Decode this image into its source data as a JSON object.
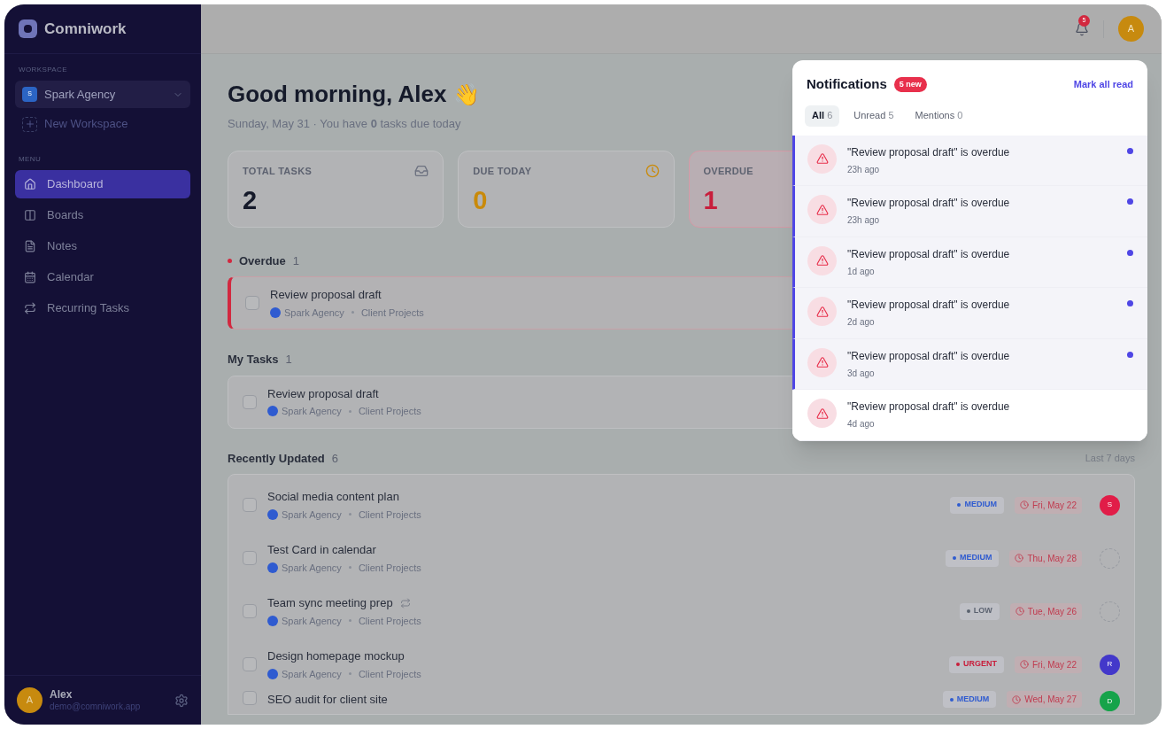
{
  "app": {
    "name": "Comniwork"
  },
  "sidebar": {
    "workspace_label": "WORKSPACE",
    "workspace": {
      "initial": "S",
      "name": "Spark Agency"
    },
    "new_workspace": "New Workspace",
    "menu_label": "MENU",
    "items": [
      {
        "label": "Dashboard",
        "kind": "home",
        "selected": true
      },
      {
        "label": "Boards",
        "kind": "boards",
        "selected": false
      },
      {
        "label": "Notes",
        "kind": "notes",
        "selected": false
      },
      {
        "label": "Calendar",
        "kind": "calendar",
        "selected": false
      },
      {
        "label": "Recurring Tasks",
        "kind": "repeat",
        "selected": false
      }
    ],
    "user": {
      "initial": "A",
      "name": "Alex",
      "email": "demo@comniwork.app"
    }
  },
  "header": {
    "bell_badge": "5",
    "avatar": "A"
  },
  "greeting": {
    "title": "Good morning, Alex",
    "emoji": "👋",
    "subtitle": "Sunday, May 31 · You have **0** tasks due today"
  },
  "stats": [
    {
      "label": "TOTAL TASKS",
      "value": "2",
      "kind": "total"
    },
    {
      "label": "DUE TODAY",
      "value": "0",
      "kind": "due"
    },
    {
      "label": "OVERDUE",
      "value": "1",
      "kind": "overdue"
    }
  ],
  "overdue": {
    "title": "Overdue",
    "count": "1",
    "tasks": [
      {
        "title": "Review proposal draft",
        "workspace": "Spark Agency",
        "project": "Client Projects",
        "checked": false
      }
    ]
  },
  "my_tasks": {
    "title": "My Tasks",
    "count": "1",
    "tasks": [
      {
        "title": "Review proposal draft",
        "workspace": "Spark Agency",
        "project": "Client Projects",
        "checked": false
      }
    ]
  },
  "recent": {
    "title": "Recently Updated",
    "count": "6",
    "range": "Last 7 days",
    "tasks": [
      {
        "title": "Social media content plan",
        "workspace": "Spark Agency",
        "project": "Client Projects",
        "checked": false,
        "recurring": false,
        "priority": {
          "label": "MEDIUM",
          "color": "#2f5bd0"
        },
        "date": "Fri, May 22",
        "assignee": {
          "initial": "S",
          "color": "#e11d48"
        }
      },
      {
        "title": "Test Card in calendar",
        "workspace": "Spark Agency",
        "project": "Client Projects",
        "checked": false,
        "recurring": false,
        "priority": {
          "label": "MEDIUM",
          "color": "#2f5bd0"
        },
        "date": "Thu, May 28"
      },
      {
        "title": "Team sync meeting prep",
        "workspace": "Spark Agency",
        "project": "Client Projects",
        "checked": false,
        "recurring": true,
        "priority": {
          "label": "LOW",
          "color": "#5b6270"
        },
        "date": "Tue, May 26"
      },
      {
        "title": "Design homepage mockup",
        "workspace": "Spark Agency",
        "project": "Client Projects",
        "checked": false,
        "recurring": false,
        "priority": {
          "label": "URGENT",
          "color": "#c81e3c"
        },
        "date": "Fri, May 22",
        "assignee": {
          "initial": "R",
          "color": "#4338ca"
        }
      },
      {
        "title": "SEO audit for client site",
        "checked": false,
        "recurring": false,
        "priority": {
          "label": "MEDIUM",
          "color": "#2f5bd0"
        },
        "date": "Wed, May 27",
        "assignee": {
          "initial": "D",
          "color": "#16a34a"
        }
      }
    ]
  },
  "notifications": {
    "title": "Notifications",
    "badge": "5 new",
    "mark_all": "Mark all read",
    "tabs": [
      {
        "label": "All",
        "count": "6",
        "selected": true
      },
      {
        "label": "Unread",
        "count": "5",
        "selected": false
      },
      {
        "label": "Mentions",
        "count": "0",
        "selected": false
      }
    ],
    "items": [
      {
        "text": "\"Review proposal draft\" is overdue",
        "time": "23h ago",
        "unread": true
      },
      {
        "text": "\"Review proposal draft\" is overdue",
        "time": "23h ago",
        "unread": true
      },
      {
        "text": "\"Review proposal draft\" is overdue",
        "time": "1d ago",
        "unread": true
      },
      {
        "text": "\"Review proposal draft\" is overdue",
        "time": "2d ago",
        "unread": true
      },
      {
        "text": "\"Review proposal draft\" is overdue",
        "time": "3d ago",
        "unread": true
      },
      {
        "text": "\"Review proposal draft\" is overdue",
        "time": "4d ago",
        "unread": false
      }
    ]
  }
}
